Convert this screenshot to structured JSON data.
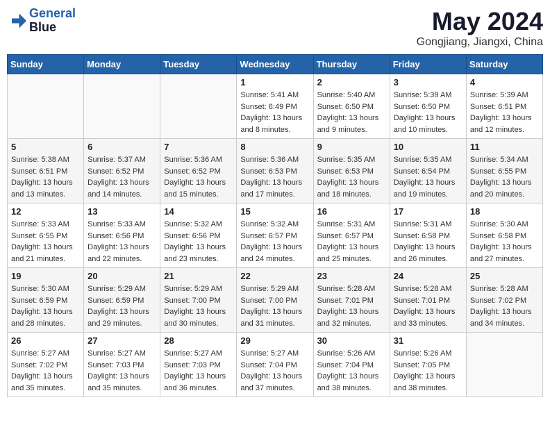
{
  "header": {
    "logo_line1": "General",
    "logo_line2": "Blue",
    "month_year": "May 2024",
    "location": "Gongjiang, Jiangxi, China"
  },
  "days_of_week": [
    "Sunday",
    "Monday",
    "Tuesday",
    "Wednesday",
    "Thursday",
    "Friday",
    "Saturday"
  ],
  "weeks": [
    [
      {
        "day": "",
        "info": ""
      },
      {
        "day": "",
        "info": ""
      },
      {
        "day": "",
        "info": ""
      },
      {
        "day": "1",
        "info": "Sunrise: 5:41 AM\nSunset: 6:49 PM\nDaylight: 13 hours\nand 8 minutes."
      },
      {
        "day": "2",
        "info": "Sunrise: 5:40 AM\nSunset: 6:50 PM\nDaylight: 13 hours\nand 9 minutes."
      },
      {
        "day": "3",
        "info": "Sunrise: 5:39 AM\nSunset: 6:50 PM\nDaylight: 13 hours\nand 10 minutes."
      },
      {
        "day": "4",
        "info": "Sunrise: 5:39 AM\nSunset: 6:51 PM\nDaylight: 13 hours\nand 12 minutes."
      }
    ],
    [
      {
        "day": "5",
        "info": "Sunrise: 5:38 AM\nSunset: 6:51 PM\nDaylight: 13 hours\nand 13 minutes."
      },
      {
        "day": "6",
        "info": "Sunrise: 5:37 AM\nSunset: 6:52 PM\nDaylight: 13 hours\nand 14 minutes."
      },
      {
        "day": "7",
        "info": "Sunrise: 5:36 AM\nSunset: 6:52 PM\nDaylight: 13 hours\nand 15 minutes."
      },
      {
        "day": "8",
        "info": "Sunrise: 5:36 AM\nSunset: 6:53 PM\nDaylight: 13 hours\nand 17 minutes."
      },
      {
        "day": "9",
        "info": "Sunrise: 5:35 AM\nSunset: 6:53 PM\nDaylight: 13 hours\nand 18 minutes."
      },
      {
        "day": "10",
        "info": "Sunrise: 5:35 AM\nSunset: 6:54 PM\nDaylight: 13 hours\nand 19 minutes."
      },
      {
        "day": "11",
        "info": "Sunrise: 5:34 AM\nSunset: 6:55 PM\nDaylight: 13 hours\nand 20 minutes."
      }
    ],
    [
      {
        "day": "12",
        "info": "Sunrise: 5:33 AM\nSunset: 6:55 PM\nDaylight: 13 hours\nand 21 minutes."
      },
      {
        "day": "13",
        "info": "Sunrise: 5:33 AM\nSunset: 6:56 PM\nDaylight: 13 hours\nand 22 minutes."
      },
      {
        "day": "14",
        "info": "Sunrise: 5:32 AM\nSunset: 6:56 PM\nDaylight: 13 hours\nand 23 minutes."
      },
      {
        "day": "15",
        "info": "Sunrise: 5:32 AM\nSunset: 6:57 PM\nDaylight: 13 hours\nand 24 minutes."
      },
      {
        "day": "16",
        "info": "Sunrise: 5:31 AM\nSunset: 6:57 PM\nDaylight: 13 hours\nand 25 minutes."
      },
      {
        "day": "17",
        "info": "Sunrise: 5:31 AM\nSunset: 6:58 PM\nDaylight: 13 hours\nand 26 minutes."
      },
      {
        "day": "18",
        "info": "Sunrise: 5:30 AM\nSunset: 6:58 PM\nDaylight: 13 hours\nand 27 minutes."
      }
    ],
    [
      {
        "day": "19",
        "info": "Sunrise: 5:30 AM\nSunset: 6:59 PM\nDaylight: 13 hours\nand 28 minutes."
      },
      {
        "day": "20",
        "info": "Sunrise: 5:29 AM\nSunset: 6:59 PM\nDaylight: 13 hours\nand 29 minutes."
      },
      {
        "day": "21",
        "info": "Sunrise: 5:29 AM\nSunset: 7:00 PM\nDaylight: 13 hours\nand 30 minutes."
      },
      {
        "day": "22",
        "info": "Sunrise: 5:29 AM\nSunset: 7:00 PM\nDaylight: 13 hours\nand 31 minutes."
      },
      {
        "day": "23",
        "info": "Sunrise: 5:28 AM\nSunset: 7:01 PM\nDaylight: 13 hours\nand 32 minutes."
      },
      {
        "day": "24",
        "info": "Sunrise: 5:28 AM\nSunset: 7:01 PM\nDaylight: 13 hours\nand 33 minutes."
      },
      {
        "day": "25",
        "info": "Sunrise: 5:28 AM\nSunset: 7:02 PM\nDaylight: 13 hours\nand 34 minutes."
      }
    ],
    [
      {
        "day": "26",
        "info": "Sunrise: 5:27 AM\nSunset: 7:02 PM\nDaylight: 13 hours\nand 35 minutes."
      },
      {
        "day": "27",
        "info": "Sunrise: 5:27 AM\nSunset: 7:03 PM\nDaylight: 13 hours\nand 35 minutes."
      },
      {
        "day": "28",
        "info": "Sunrise: 5:27 AM\nSunset: 7:03 PM\nDaylight: 13 hours\nand 36 minutes."
      },
      {
        "day": "29",
        "info": "Sunrise: 5:27 AM\nSunset: 7:04 PM\nDaylight: 13 hours\nand 37 minutes."
      },
      {
        "day": "30",
        "info": "Sunrise: 5:26 AM\nSunset: 7:04 PM\nDaylight: 13 hours\nand 38 minutes."
      },
      {
        "day": "31",
        "info": "Sunrise: 5:26 AM\nSunset: 7:05 PM\nDaylight: 13 hours\nand 38 minutes."
      },
      {
        "day": "",
        "info": ""
      }
    ]
  ]
}
